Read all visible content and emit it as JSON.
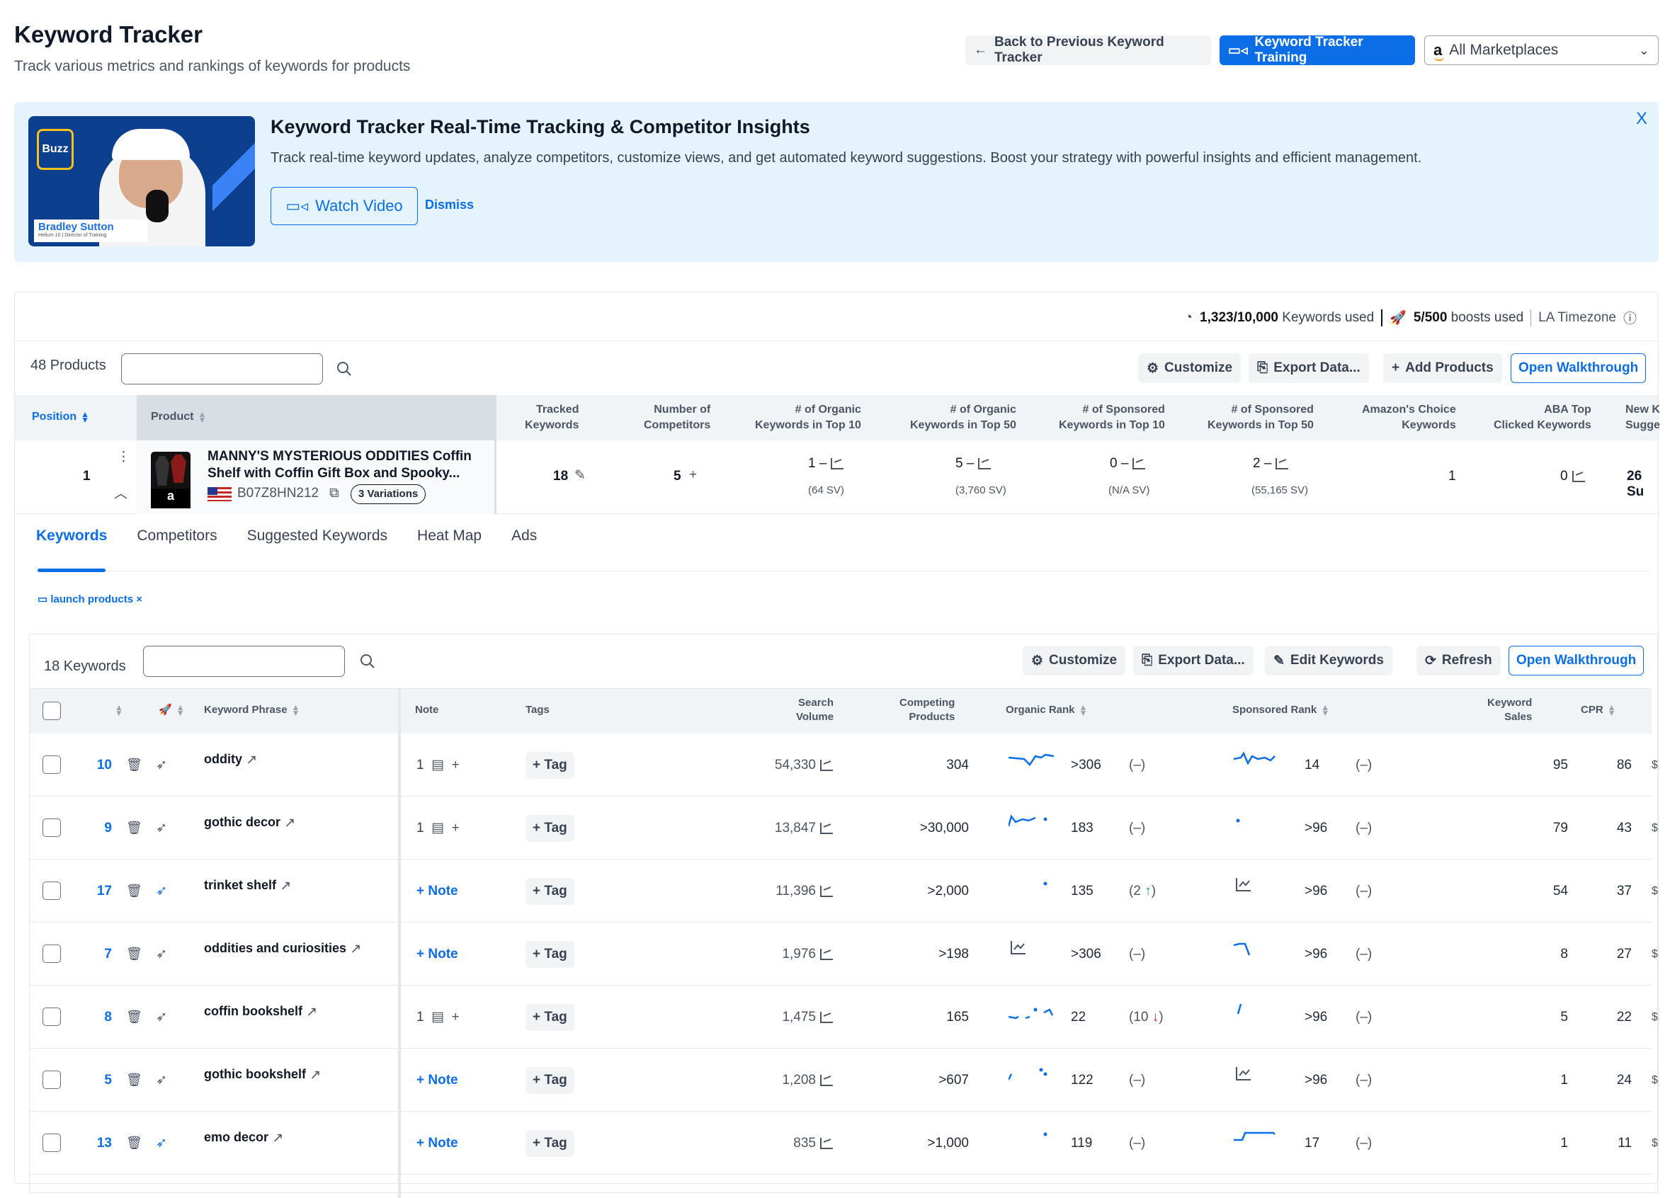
{
  "header": {
    "title": "Keyword Tracker",
    "subtitle": "Track various metrics and rankings of keywords for products",
    "back_button": "Back to Previous Keyword Tracker",
    "training_button": "Keyword Tracker Training",
    "marketplace": "All Marketplaces"
  },
  "banner": {
    "title": "Keyword Tracker Real-Time Tracking & Competitor Insights",
    "description": "Track real-time keyword updates, analyze competitors, customize views, and get automated keyword suggestions. Boost your strategy with powerful insights and efficient management.",
    "watch_button": "Watch Video",
    "dismiss": "Dismiss",
    "close": "X",
    "thumbnail": {
      "badge": "Buzz",
      "presenter": "Bradley Sutton",
      "role": "Helium 10 | Director of Training"
    }
  },
  "usage": {
    "keywords_used": "1,323/10,000",
    "keywords_label": "Keywords used",
    "boosts_used": "5/500",
    "boosts_label": "boosts used",
    "timezone": "LA Timezone"
  },
  "products_toolbar": {
    "count": "48 Products",
    "search_placeholder": "",
    "customize": "Customize",
    "export": "Export Data...",
    "add_products": "Add Products",
    "walkthrough": "Open Walkthrough"
  },
  "products_table": {
    "headers": {
      "position": "Position",
      "product": "Product",
      "tracked": [
        "Tracked",
        "Keywords"
      ],
      "competitors": [
        "Number of",
        "Competitors"
      ],
      "org10": [
        "# of Organic",
        "Keywords in Top 10"
      ],
      "org50": [
        "# of Organic",
        "Keywords in Top 50"
      ],
      "spon10": [
        "# of Sponsored",
        "Keywords in Top 10"
      ],
      "spon50": [
        "# of Sponsored",
        "Keywords in Top 50"
      ],
      "choice": [
        "Amazon's Choice",
        "Keywords"
      ],
      "aba": [
        "ABA Top",
        "Clicked Keywords"
      ],
      "newk": [
        "New K",
        "Sugge"
      ]
    },
    "row": {
      "position": "1",
      "title_line1": "MANNY'S MYSTERIOUS ODDITIES Coffin",
      "title_line2": "Shelf with Coffin Gift Box and Spooky...",
      "asin": "B07Z8HN212",
      "variations": "3 Variations",
      "tracked": "18",
      "competitors": "5",
      "org10": "1",
      "org10_sv": "(64 SV)",
      "org50": "5",
      "org50_sv": "(3,760 SV)",
      "spon10": "0",
      "spon10_sv": "(N/A SV)",
      "spon50": "2",
      "spon50_sv": "(55,165 SV)",
      "choice": "1",
      "aba": "0",
      "newk": "26 Su",
      "dash": "–"
    }
  },
  "tabs": [
    {
      "label": "Keywords",
      "active": true
    },
    {
      "label": "Competitors"
    },
    {
      "label": "Suggested Keywords"
    },
    {
      "label": "Heat Map"
    },
    {
      "label": "Ads"
    }
  ],
  "tag_filter": "launch products",
  "keywords_toolbar": {
    "count": "18 Keywords",
    "customize": "Customize",
    "export": "Export Data...",
    "edit": "Edit Keywords",
    "refresh": "Refresh",
    "walkthrough": "Open Walkthrough"
  },
  "keywords_table": {
    "headers": {
      "phrase": "Keyword Phrase",
      "note": "Note",
      "tags": "Tags",
      "sv": [
        "Search",
        "Volume"
      ],
      "competing": [
        "Competing",
        "Products"
      ],
      "organic": "Organic Rank",
      "sponsored": "Sponsored Rank",
      "sales": [
        "Keyword",
        "Sales"
      ],
      "cpr": "CPR"
    },
    "add_note": "Note",
    "add_tag": "Tag",
    "rows": [
      {
        "id": "10",
        "phrase": "oddity",
        "notes": "1",
        "sv": "54,330",
        "competing": "304",
        "org_rank": ">306",
        "org_change": "(–)",
        "spon_rank": "14",
        "spon_change": "(–)",
        "sales": "95",
        "cpr": "86",
        "boost": false
      },
      {
        "id": "9",
        "phrase": "gothic decor",
        "notes": "1",
        "sv": "13,847",
        "competing": ">30,000",
        "org_rank": "183",
        "org_change": "(–)",
        "spon_rank": ">96",
        "spon_change": "(–)",
        "sales": "79",
        "cpr": "43",
        "boost": false
      },
      {
        "id": "17",
        "phrase": "trinket shelf",
        "notes": "",
        "sv": "11,396",
        "competing": ">2,000",
        "org_rank": "135",
        "org_change": "(2 ↑)",
        "org_dir": "up",
        "spon_rank": ">96",
        "spon_change": "(–)",
        "sales": "54",
        "cpr": "37",
        "boost": true
      },
      {
        "id": "7",
        "phrase": "oddities and curiosities",
        "notes": "",
        "sv": "1,976",
        "competing": ">198",
        "org_rank": ">306",
        "org_change": "(–)",
        "spon_rank": ">96",
        "spon_change": "(–)",
        "sales": "8",
        "cpr": "27",
        "boost": false
      },
      {
        "id": "8",
        "phrase": "coffin bookshelf",
        "notes": "1",
        "sv": "1,475",
        "competing": "165",
        "org_rank": "22",
        "org_change": "(10 ↓)",
        "org_dir": "down",
        "spon_rank": ">96",
        "spon_change": "(–)",
        "sales": "5",
        "cpr": "22",
        "boost": false
      },
      {
        "id": "5",
        "phrase": "gothic bookshelf",
        "notes": "",
        "sv": "1,208",
        "competing": ">607",
        "org_rank": "122",
        "org_change": "(–)",
        "spon_rank": ">96",
        "spon_change": "(–)",
        "sales": "1",
        "cpr": "24",
        "boost": false
      },
      {
        "id": "13",
        "phrase": "emo decor",
        "notes": "",
        "sv": "835",
        "competing": ">1,000",
        "org_rank": "119",
        "org_change": "(–)",
        "spon_rank": "17",
        "spon_change": "(–)",
        "sales": "1",
        "cpr": "11",
        "boost": true
      }
    ]
  },
  "colors": {
    "accent": "#0b6ee6",
    "up": "#16a34a",
    "down": "#dc2626",
    "banner_bg": "#e5f3fd"
  }
}
